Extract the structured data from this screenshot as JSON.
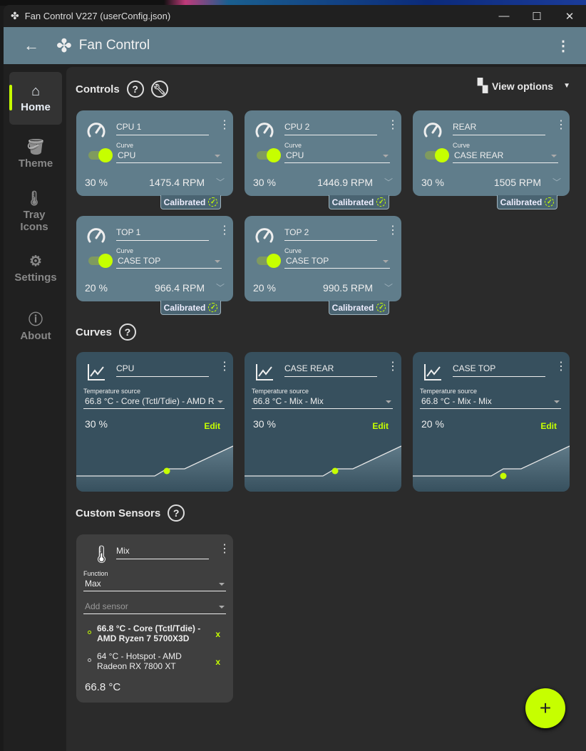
{
  "window": {
    "title": "Fan Control V227 (userConfig.json)",
    "minimize": "—",
    "maximize": "☐",
    "close": "✕"
  },
  "appbar": {
    "title": "Fan Control",
    "back": "←",
    "more": "⋮"
  },
  "sidebar": {
    "items": [
      {
        "label": "Home",
        "icon": "⌂"
      },
      {
        "label": "Theme",
        "icon": "🪣"
      },
      {
        "label": "Tray Icons",
        "icon": "🌡"
      },
      {
        "label": "Settings",
        "icon": "⚙"
      },
      {
        "label": "About",
        "icon": "ⓘ"
      }
    ]
  },
  "sections": {
    "controls": "Controls",
    "curves": "Curves",
    "custom_sensors": "Custom Sensors",
    "help": "?",
    "view_options": "View options"
  },
  "controls": [
    {
      "name": "CPU 1",
      "curve_label": "Curve",
      "curve": "CPU",
      "percent": "30 %",
      "rpm": "1475.4 RPM",
      "badge": "Calibrated",
      "enabled": true
    },
    {
      "name": "CPU 2",
      "curve_label": "Curve",
      "curve": "CPU",
      "percent": "30 %",
      "rpm": "1446.9 RPM",
      "badge": "Calibrated",
      "enabled": true
    },
    {
      "name": "REAR",
      "curve_label": "Curve",
      "curve": "CASE REAR",
      "percent": "30 %",
      "rpm": "1505 RPM",
      "badge": "Calibrated",
      "enabled": true
    },
    {
      "name": "TOP 1",
      "curve_label": "Curve",
      "curve": "CASE TOP",
      "percent": "20 %",
      "rpm": "966.4 RPM",
      "badge": "Calibrated",
      "enabled": true
    },
    {
      "name": "TOP 2",
      "curve_label": "Curve",
      "curve": "CASE TOP",
      "percent": "20 %",
      "rpm": "990.5 RPM",
      "badge": "Calibrated",
      "enabled": true
    }
  ],
  "curves": [
    {
      "name": "CPU",
      "source_label": "Temperature source",
      "source": "66.8 °C - Core (Tctl/Tdie) - AMD R",
      "percent": "30 %",
      "edit": "Edit"
    },
    {
      "name": "CASE REAR",
      "source_label": "Temperature source",
      "source": "66.8 °C - Mix - Mix",
      "percent": "30 %",
      "edit": "Edit"
    },
    {
      "name": "CASE TOP",
      "source_label": "Temperature source",
      "source": "66.8 °C - Mix - Mix",
      "percent": "20 %",
      "edit": "Edit"
    }
  ],
  "custom_sensor": {
    "name": "Mix",
    "function_label": "Function",
    "function": "Max",
    "add_placeholder": "Add sensor",
    "sensors": [
      {
        "text": "66.8 °C - Core (Tctl/Tdie) - AMD Ryzen 7 5700X3D",
        "remove": "x",
        "active": true
      },
      {
        "text": "64 °C - Hotspot - AMD Radeon RX 7800 XT",
        "remove": "x",
        "active": false
      }
    ],
    "value": "66.8 °C"
  },
  "fab": "+",
  "colors": {
    "accent": "#c6ff00",
    "appbar": "#607d8b",
    "curve_card": "#37505e"
  }
}
